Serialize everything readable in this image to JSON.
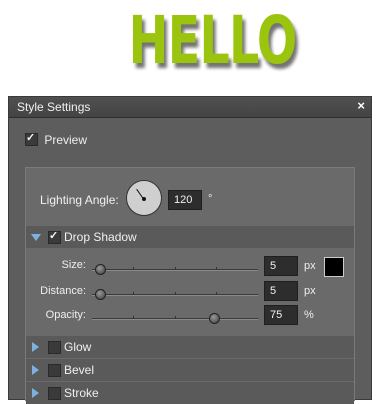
{
  "preview_text": "HELLO",
  "dialog": {
    "title": "Style Settings",
    "close_glyph": "×",
    "preview_label": "Preview",
    "preview_checked": true
  },
  "lighting": {
    "label": "Lighting Angle:",
    "value": "120",
    "unit": "°"
  },
  "drop_shadow": {
    "label": "Drop Shadow",
    "enabled": true,
    "expanded": true,
    "color": "#000000",
    "sliders": [
      {
        "label": "Size:",
        "value": "5",
        "unit": "px",
        "level": 0.02
      },
      {
        "label": "Distance:",
        "value": "5",
        "unit": "px",
        "level": 0.02
      },
      {
        "label": "Opacity:",
        "value": "75",
        "unit": "%",
        "level": 0.75
      }
    ]
  },
  "sections": [
    {
      "label": "Glow",
      "enabled": false
    },
    {
      "label": "Bevel",
      "enabled": false
    },
    {
      "label": "Stroke",
      "enabled": false
    }
  ],
  "colors": {
    "preview_green": "#9ac40e",
    "disclosure": "#7fb0e0"
  }
}
